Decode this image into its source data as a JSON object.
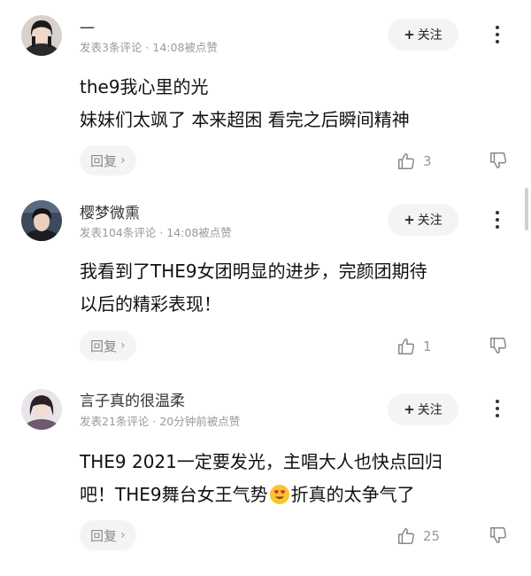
{
  "follow_label": "关注",
  "reply_label": "回复",
  "comments": [
    {
      "username": "一",
      "meta": "发表3条评论 · 14:08被点赞",
      "lines": [
        "the9我心里的光",
        "妹妹们太飒了 本来超困 看完之后瞬间精神"
      ],
      "likes": "3"
    },
    {
      "username": "樱梦微熏",
      "meta": "发表104条评论 · 14:08被点赞",
      "lines": [
        "我看到了THE9女团明显的进步，完颜团期待",
        "以后的精彩表现！"
      ],
      "likes": "1"
    },
    {
      "username": "言子真的很温柔",
      "meta": "发表21条评论 · 20分钟前被点赞",
      "lines_3": {
        "line1": "THE9 2021一定要发光，主唱大人也快点回归",
        "line2_before": "吧！THE9舞台女王气势",
        "emoji": "heart-eyes-emoji",
        "line2_after": "折真的太争气了"
      },
      "likes": "25"
    }
  ]
}
